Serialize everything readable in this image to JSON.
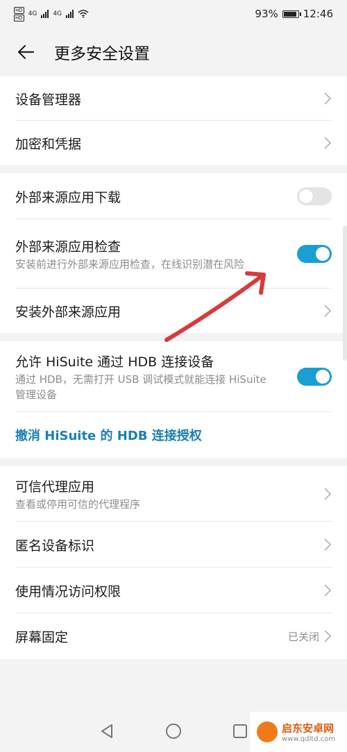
{
  "status_bar": {
    "network1": "HD",
    "network2": "HD",
    "sig1_label": "4G",
    "sig2_label": "4G",
    "battery_text": "93%",
    "battery_level": 0.93,
    "time": "12:46"
  },
  "header": {
    "title": "更多安全设置"
  },
  "sections": {
    "s1": {
      "device_manager": "设备管理器",
      "encryption": "加密和凭据"
    },
    "s2": {
      "external_download": "外部来源应用下载",
      "external_download_on": false,
      "external_check": "外部来源应用检查",
      "external_check_desc": "安装前进行外部来源应用检查，在线识别潜在风险",
      "external_check_on": true,
      "install_external": "安装外部来源应用"
    },
    "s3": {
      "hisuite_allow": "允许 HiSuite 通过 HDB 连接设备",
      "hisuite_allow_desc": "通过 HDB，无需打开 USB 调试模式就能连接 HiSuite 管理设备",
      "hisuite_allow_on": true,
      "hisuite_revoke": "撤消 HiSuite 的 HDB 连接授权"
    },
    "s4": {
      "trust_agents": "可信代理应用",
      "trust_agents_desc": "查看或停用可信的代理程序",
      "anonymous_id": "匿名设备标识",
      "usage_access": "使用情况访问权限",
      "screen_pinning": "屏幕固定",
      "screen_pinning_value": "已关闭"
    }
  },
  "watermark": {
    "name": "启东安卓网",
    "url": "www.qdltd.com"
  },
  "colors": {
    "accent": "#1a9fd4",
    "link": "#1a7fb3",
    "annotation_arrow": "#d93a3a"
  }
}
